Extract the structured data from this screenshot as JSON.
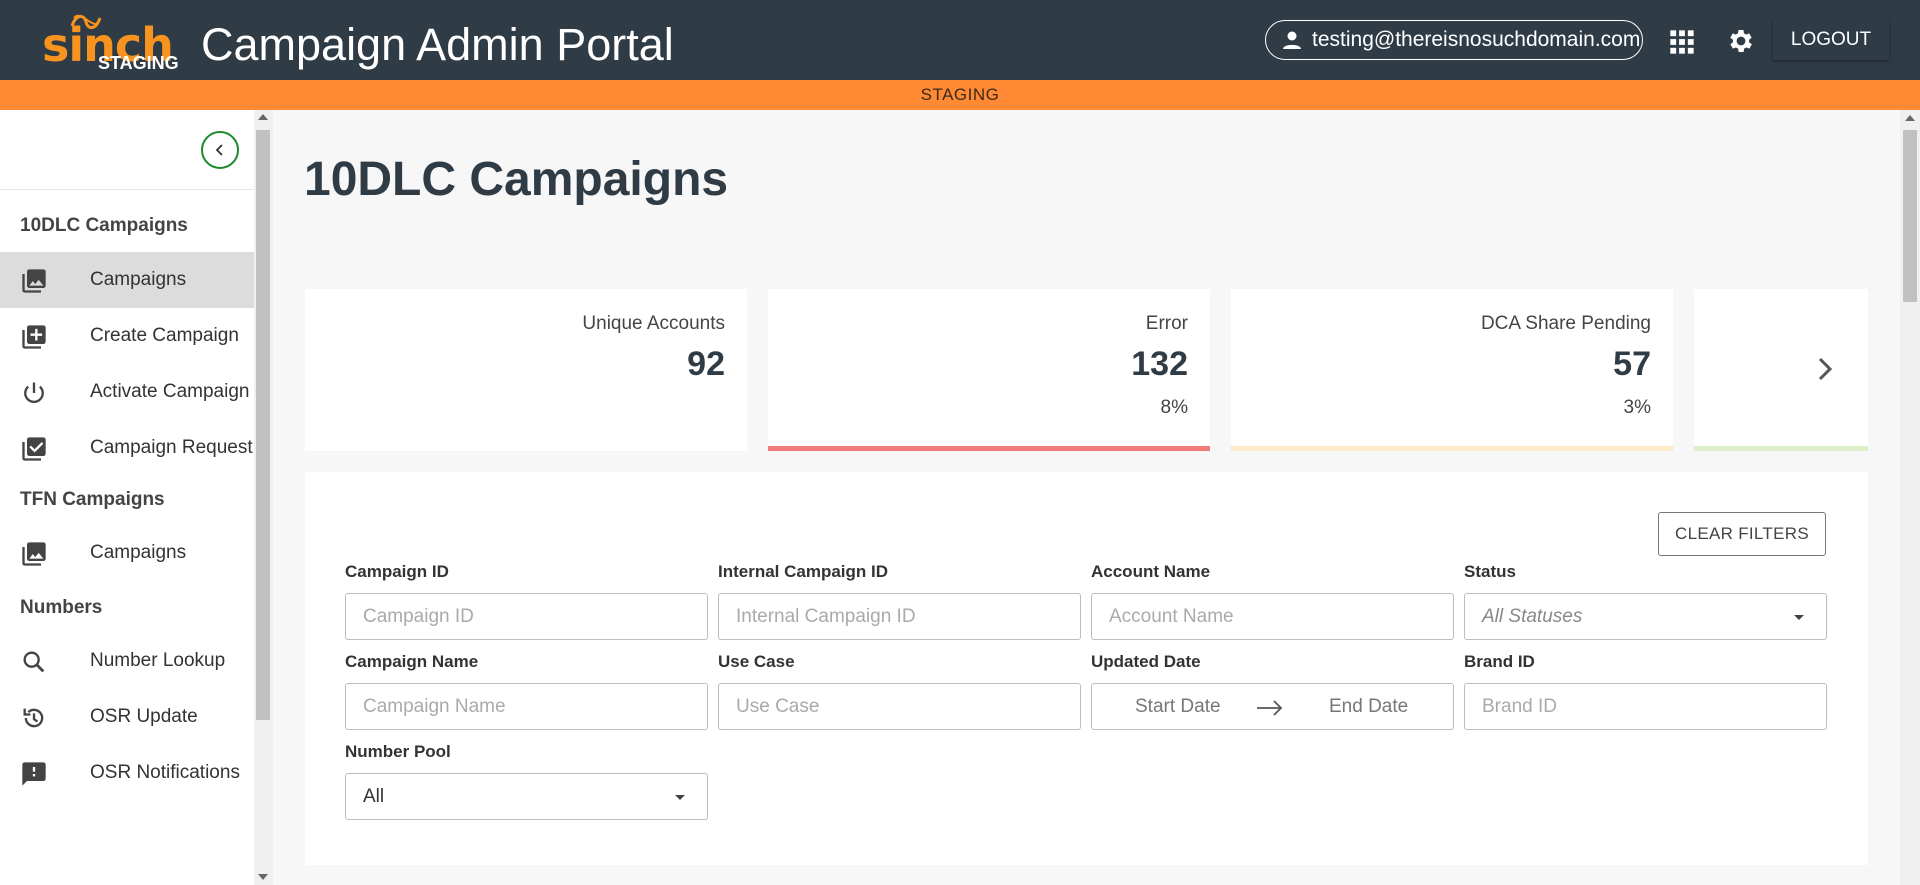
{
  "header": {
    "logo_text": "sinch",
    "logo_tag": "STAGING",
    "app_title": "Campaign Admin Portal",
    "user_email": "testing@thereisnosuchdomain.com",
    "logout_label": "LOGOUT",
    "brand_color": "#f7931e",
    "bar_color": "#2f3b45"
  },
  "env_banner": {
    "label": "STAGING",
    "color": "#ff8a33"
  },
  "sidebar": {
    "sections": [
      {
        "title": "10DLC Campaigns",
        "items": [
          {
            "label": "Campaigns",
            "icon": "photo-library-icon",
            "active": true
          },
          {
            "label": "Create Campaign",
            "icon": "library-add-icon"
          },
          {
            "label": "Activate Campaign",
            "icon": "power-icon"
          },
          {
            "label": "Campaign Request",
            "icon": "library-check-icon"
          }
        ]
      },
      {
        "title": "TFN Campaigns",
        "items": [
          {
            "label": "Campaigns",
            "icon": "photo-library-icon"
          }
        ]
      },
      {
        "title": "Numbers",
        "items": [
          {
            "label": "Number Lookup",
            "icon": "search-icon"
          },
          {
            "label": "OSR Update",
            "icon": "history-icon"
          },
          {
            "label": "OSR Notifications",
            "icon": "feedback-icon"
          }
        ]
      }
    ]
  },
  "main": {
    "page_title": "10DLC Campaigns",
    "stat_cards": [
      {
        "label": "Unique Accounts",
        "value": "92",
        "percent": "",
        "bar_color": ""
      },
      {
        "label": "Error",
        "value": "132",
        "percent": "8%",
        "bar_color": "#f07c7c"
      },
      {
        "label": "DCA Share Pending",
        "value": "57",
        "percent": "3%",
        "bar_color": "#fdebc8"
      },
      {
        "label": "",
        "value": "",
        "percent": "",
        "bar_color": "#dcefc9"
      }
    ],
    "filters": {
      "clear_label": "CLEAR FILTERS",
      "campaign_id": {
        "label": "Campaign ID",
        "placeholder": "Campaign ID"
      },
      "internal_campaign_id": {
        "label": "Internal Campaign ID",
        "placeholder": "Internal Campaign ID"
      },
      "account_name": {
        "label": "Account Name",
        "placeholder": "Account Name"
      },
      "status": {
        "label": "Status",
        "value": "All Statuses"
      },
      "campaign_name": {
        "label": "Campaign Name",
        "placeholder": "Campaign Name"
      },
      "use_case": {
        "label": "Use Case",
        "placeholder": "Use Case"
      },
      "updated_date": {
        "label": "Updated Date",
        "start": "Start Date",
        "end": "End Date"
      },
      "brand_id": {
        "label": "Brand ID",
        "placeholder": "Brand ID"
      },
      "number_pool": {
        "label": "Number Pool",
        "value": "All"
      }
    }
  }
}
